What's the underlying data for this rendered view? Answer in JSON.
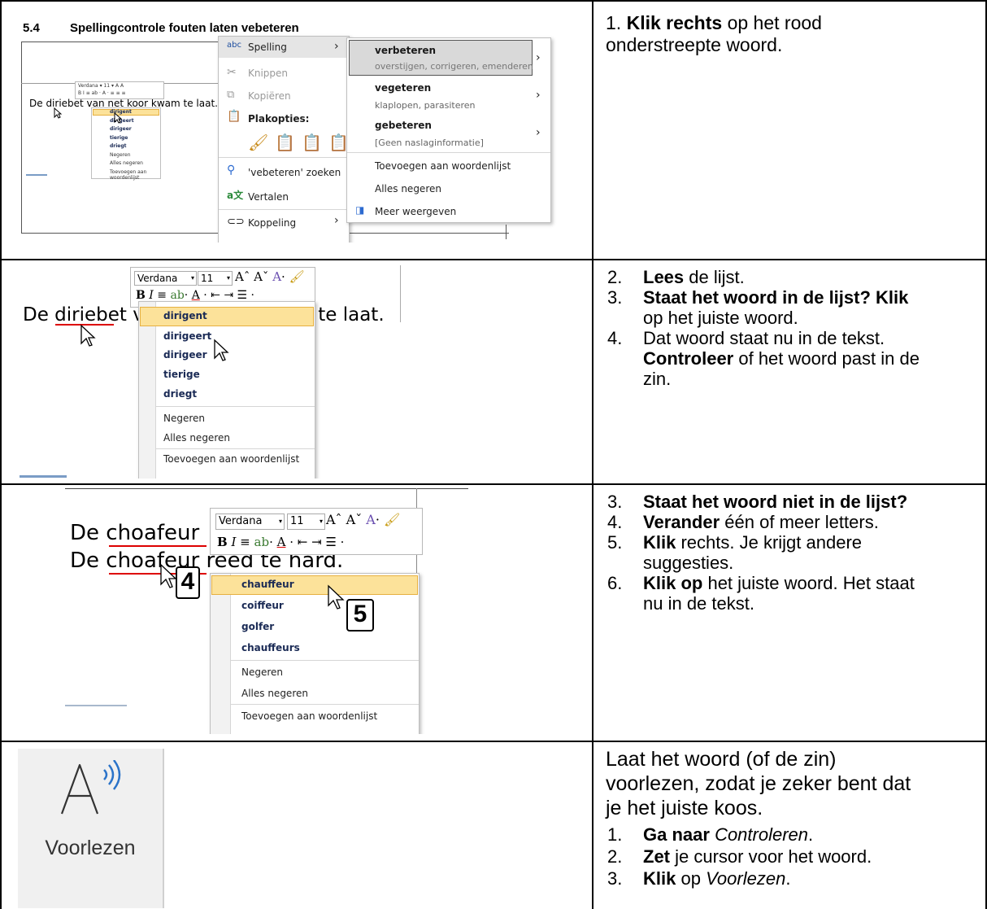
{
  "row1": {
    "heading_num": "5.4",
    "heading_text": "Spellingcontrole fouten laten vebeteren",
    "doc_sentence": "De diriebet van net koor kwam te laat.",
    "small_menu": [
      "dirigent",
      "dirigeert",
      "dirigeer",
      "tierige",
      "driegt",
      "Negeren",
      "Alles negeren",
      "Toevoegen aan woordenlijst"
    ],
    "context_menu": {
      "spelling": "Spelling",
      "knippen": "Knippen",
      "kopieren": "Kopiëren",
      "plakopties": "Plakopties:",
      "zoeken": "'vebeteren' zoeken",
      "vertalen": "Vertalen",
      "koppeling": "Koppeling"
    },
    "submenu": {
      "s1_word": "verbeteren",
      "s1_syn": "overstijgen, corrigeren, emenderen",
      "s2_word": "vegeteren",
      "s2_syn": "klaplopen, parasiteren",
      "s3_word": "gebeteren",
      "s3_syn": "[Geen naslaginformatie]",
      "add": "Toevoegen aan woordenlijst",
      "ignore_all": "Alles negeren",
      "more": "Meer weergeven"
    },
    "instr_num": "1.",
    "instr_bold": "Klik rechts",
    "instr_rest1": " op het rood",
    "instr_rest2": "onderstreepte woord."
  },
  "row2": {
    "toolbar_font": "Verdana",
    "toolbar_size": "11",
    "sentence": "De diriebet van net koor kwam te laat.",
    "suggestions": [
      "dirigent",
      "dirigeert",
      "dirigeer",
      "tierige",
      "driegt"
    ],
    "actions": [
      "Negeren",
      "Alles negeren",
      "Toevoegen aan woordenlijst"
    ],
    "items": [
      {
        "n": "2.",
        "b": "Lees",
        "t": " de lijst."
      },
      {
        "n": "3.",
        "b": "Staat het woord in de lijst? Klik",
        "t": ""
      },
      {
        "n": "",
        "b": "",
        "t": "op het juiste woord."
      },
      {
        "n": "4.",
        "b": "",
        "t": "Dat woord staat nu in de tekst."
      },
      {
        "n": "",
        "b": "Controleer",
        "t": " of het woord past in de"
      },
      {
        "n": "",
        "b": "",
        "t": "zin."
      }
    ]
  },
  "row3": {
    "line1": "De choafeur",
    "line2": "De choafeur reed te hard.",
    "toolbar_font": "Verdana",
    "toolbar_size": "11",
    "suggestions": [
      "chauffeur",
      "coiffeur",
      "golfer",
      "chauffeurs"
    ],
    "actions": [
      "Negeren",
      "Alles negeren",
      "Toevoegen aan woordenlijst"
    ],
    "badge4": "4",
    "badge5": "5",
    "items": [
      {
        "n": "3.",
        "b": "Staat het woord niet in de lijst?",
        "t": ""
      },
      {
        "n": "4.",
        "b": "Verander",
        "t": " één of meer letters."
      },
      {
        "n": "5.",
        "b": "Klik",
        "t": " rechts. Je krijgt andere"
      },
      {
        "n": "",
        "b": "",
        "t": "suggesties."
      },
      {
        "n": "6.",
        "b": "Klik op",
        "t": " het juiste woord. Het staat"
      },
      {
        "n": "",
        "b": "",
        "t": "nu in de tekst."
      }
    ]
  },
  "row4": {
    "button_label": "Voorlezen",
    "intro1": "Laat het woord (of de zin)",
    "intro2": "voorlezen, zodat je zeker bent dat",
    "intro3": "je het juiste koos.",
    "items": [
      {
        "n": "1.",
        "b": "Ga naar",
        "t": " ",
        "i": "Controleren",
        "e": "."
      },
      {
        "n": "2.",
        "b": "Zet",
        "t": " je cursor voor het woord.",
        "i": "",
        "e": ""
      },
      {
        "n": "3.",
        "b": "Klik",
        "t": " op ",
        "i": "Voorlezen",
        "e": "."
      }
    ]
  },
  "icons": [
    "speaker-a-icon",
    "mouse-cursor-icon",
    "scissors-icon",
    "copy-icon",
    "paste-icon",
    "search-icon",
    "translate-icon",
    "link-icon",
    "chevron-right-icon",
    "format-painter-icon",
    "show-more-icon"
  ]
}
